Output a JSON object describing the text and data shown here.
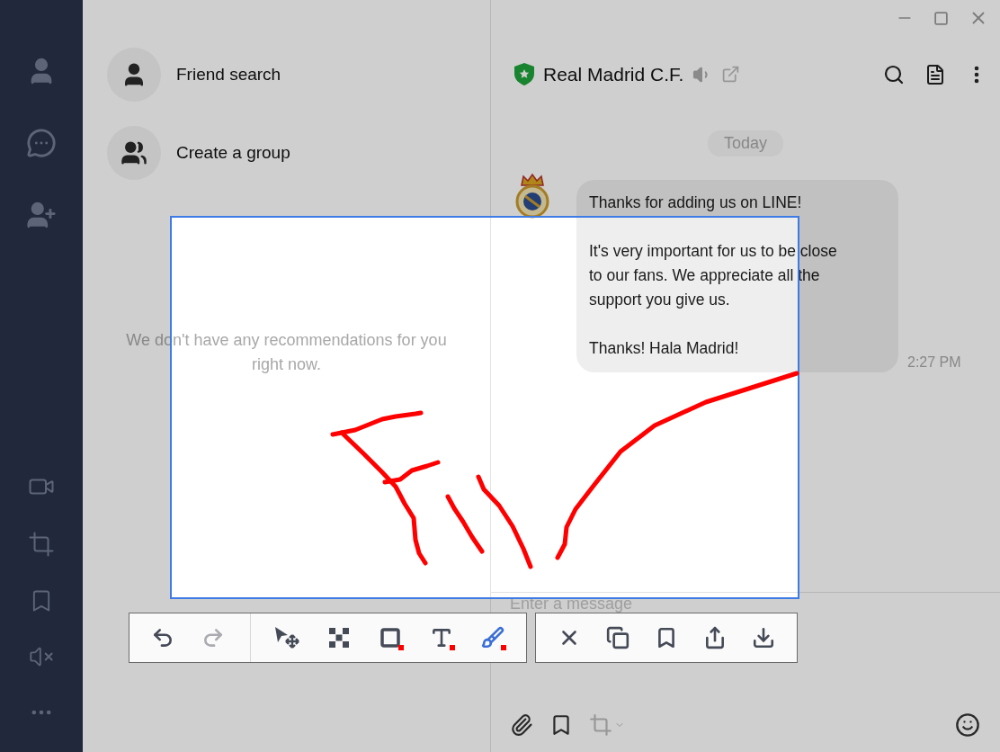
{
  "friend_actions": [
    {
      "kind": "search",
      "label": "Friend search"
    },
    {
      "kind": "group",
      "label": "Create a group"
    }
  ],
  "empty_message": "We don't have any recommendations for you right now.",
  "chat": {
    "title": "Real Madrid C.F.",
    "date": "Today",
    "messages": [
      {
        "paragraphs": [
          "Thanks for adding us on LINE!",
          "It's very important for us to be close to our fans. We appreciate all the support you give us.",
          "Thanks! Hala Madrid!"
        ],
        "time": "2:27 PM"
      }
    ],
    "input": {
      "placeholder": "Enter a message"
    }
  },
  "capture_toolbar": {
    "groups": [
      {
        "tools": [
          {
            "kind": "undo",
            "disabled": false
          },
          {
            "kind": "redo",
            "disabled": true
          }
        ]
      },
      {
        "tools": [
          {
            "kind": "select",
            "selected": false
          },
          {
            "kind": "mosaic",
            "selected": false
          },
          {
            "kind": "rectangle",
            "selected": false,
            "color": "#ff0000"
          },
          {
            "kind": "text",
            "selected": false,
            "color": "#ff0000"
          },
          {
            "kind": "brush",
            "selected": true,
            "color": "#ff0000"
          }
        ]
      },
      {
        "tools": [
          {
            "kind": "close"
          },
          {
            "kind": "copy"
          },
          {
            "kind": "bookmark"
          },
          {
            "kind": "share"
          },
          {
            "kind": "download"
          }
        ]
      }
    ]
  }
}
